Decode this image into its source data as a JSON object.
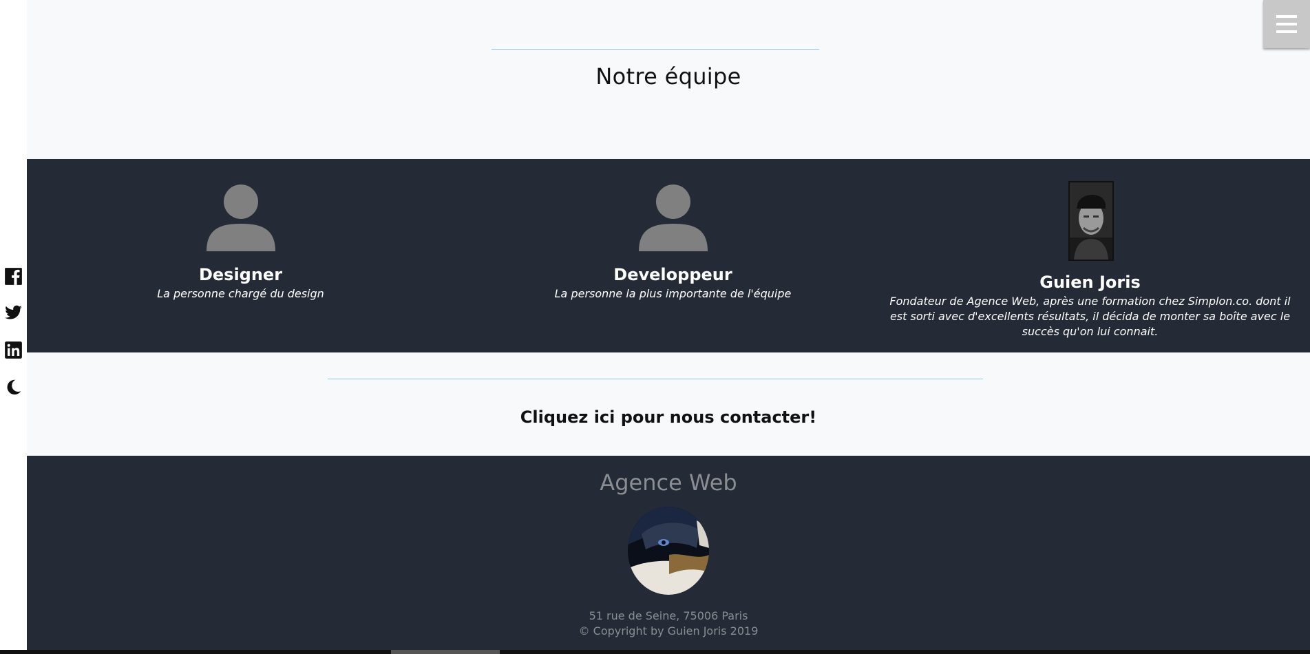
{
  "team_section": {
    "title": "Notre équipe"
  },
  "team": [
    {
      "name": "Designer",
      "description": "La personne chargé du design",
      "avatar_icon": "user-silhouette-icon"
    },
    {
      "name": "Developpeur",
      "description": "La personne la plus importante de l'équipe",
      "avatar_icon": "user-silhouette-icon"
    },
    {
      "name": "Guien Joris",
      "description": "Fondateur de Agence Web, après une formation chez Simplon.co. dont il est sorti avec d'excellents résultats, il décida de monter sa boîte avec le succès qu'on lui connait.",
      "avatar_icon": "profile-photo"
    }
  ],
  "contact": {
    "label": "Cliquez ici pour nous contacter!"
  },
  "footer": {
    "brand": "Agence Web",
    "address": "51 rue de Seine, 75006 Paris",
    "copyright": "© Copyright by Guien Joris 2019"
  },
  "social": [
    "facebook-icon",
    "twitter-icon",
    "linkedin-icon",
    "moon-icon"
  ],
  "colors": {
    "dark_band": "#252b36",
    "light_bg": "#f7f9fb",
    "accent_rule": "#8fc7dd",
    "muted_text": "#8a8d92",
    "placeholder_gray": "#808080"
  }
}
